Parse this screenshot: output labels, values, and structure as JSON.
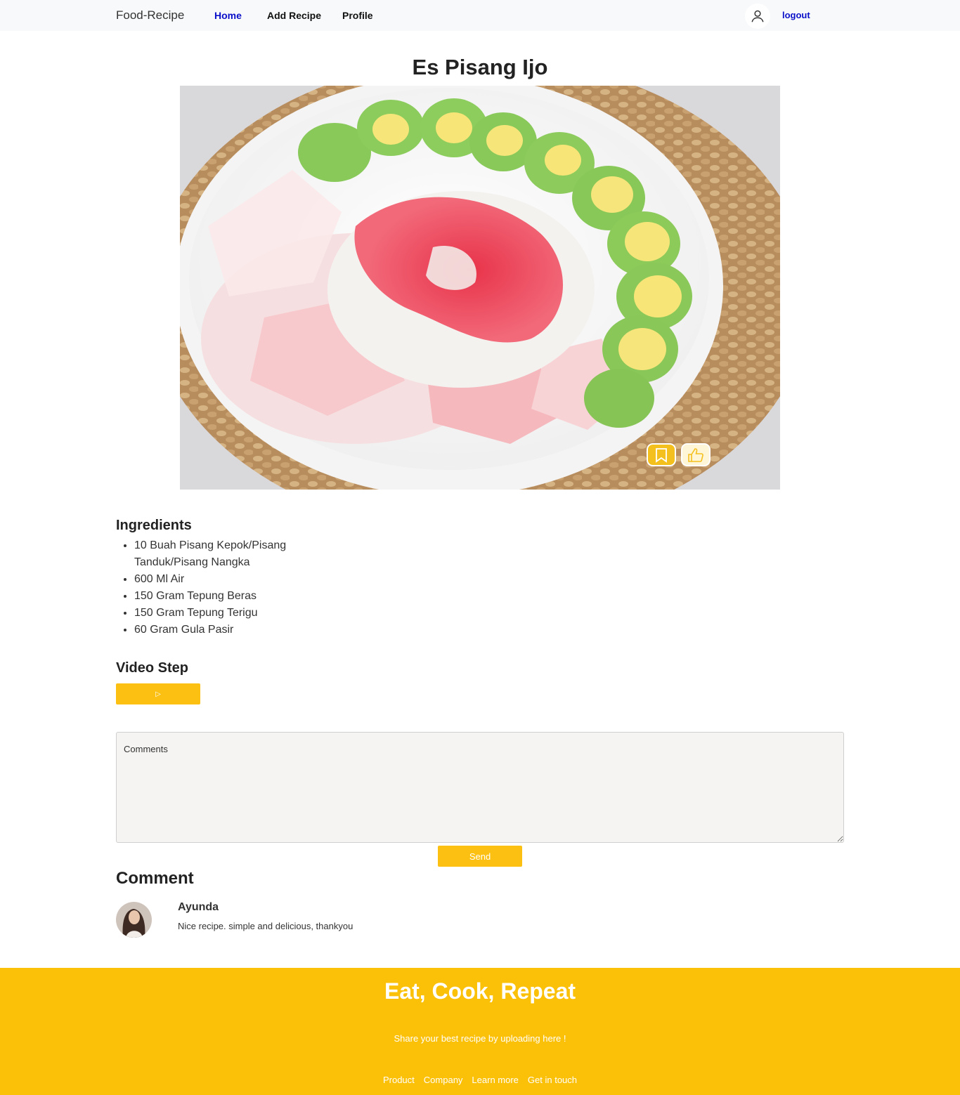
{
  "navbar": {
    "brand": "Food-Recipe",
    "links": [
      "Home",
      "Add Recipe",
      "Profile"
    ],
    "active_link": "Home",
    "logout": "logout",
    "accent_color": "#0a10c9"
  },
  "recipe": {
    "title": "Es Pisang Ijo",
    "ingredients_heading": "Ingredients",
    "ingredients": [
      "10 Buah Pisang Kepok/Pisang Tanduk/Pisang Nangka",
      "600 Ml Air",
      "150 Gram Tepung Beras",
      "150 Gram Tepung Terigu",
      "60 Gram Gula Pasir"
    ],
    "video_heading": "Video Step",
    "video_button_icon": "play-icon",
    "video_button_label": "▷"
  },
  "comment_form": {
    "placeholder": "Comments",
    "send_label": "Send"
  },
  "comments": {
    "heading": "Comment",
    "items": [
      {
        "name": "Ayunda",
        "text": "Nice recipe. simple and delicious, thankyou"
      }
    ]
  },
  "footer": {
    "title": "Eat, Cook, Repeat",
    "subtitle": "Share your best recipe by uploading here !",
    "links": [
      "Product",
      "Company",
      "Learn more",
      "Get in touch"
    ],
    "background_color": "#fbc008"
  },
  "theme": {
    "button_color": "#fbc012"
  }
}
